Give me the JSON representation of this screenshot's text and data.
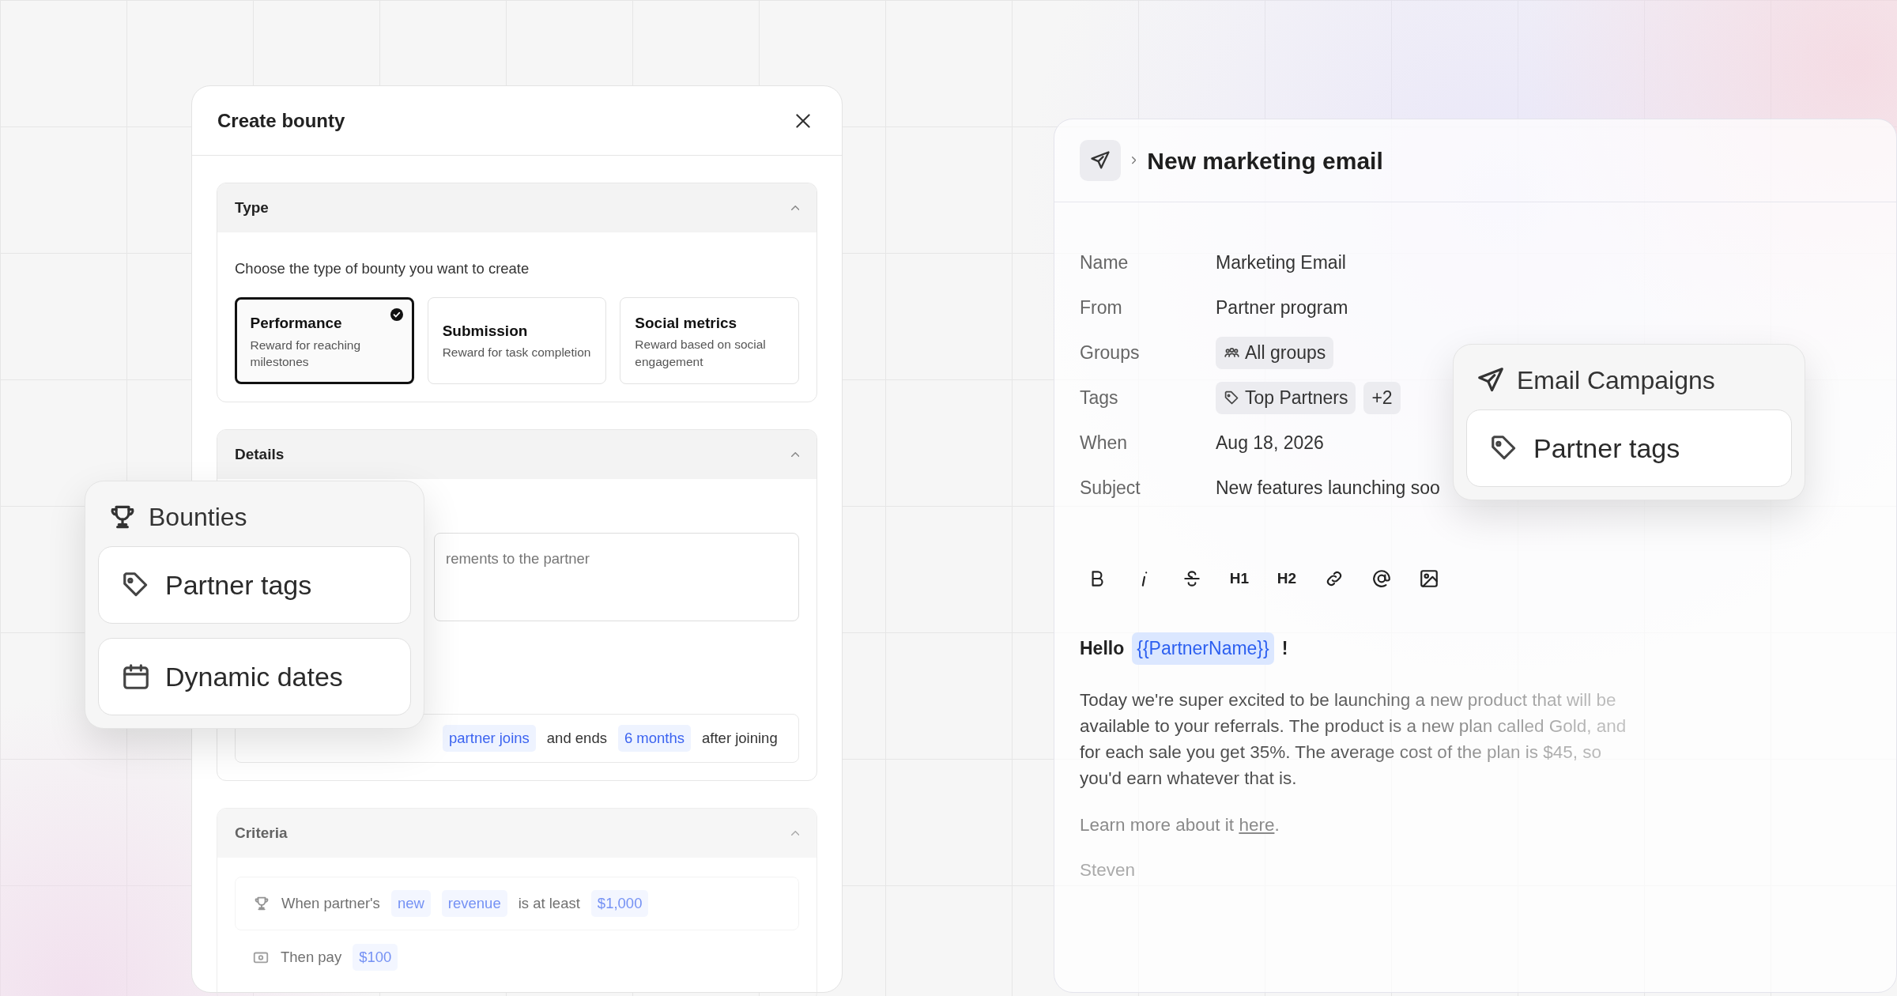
{
  "bounty_dialog": {
    "title": "Create bounty",
    "type_section": {
      "title": "Type",
      "expanded": true,
      "prompt": "Choose the type of bounty you want to create",
      "options": [
        {
          "title": "Performance",
          "description": "Reward for reaching milestones",
          "selected": true
        },
        {
          "title": "Submission",
          "description": "Reward for task completion",
          "selected": false
        },
        {
          "title": "Social metrics",
          "description": "Reward based on social engagement",
          "selected": false
        }
      ]
    },
    "details_section": {
      "title": "Details",
      "expanded": true,
      "placeholder": "rements to the partner",
      "date_rule": [
        {
          "kind": "chip",
          "text": "partner joins"
        },
        {
          "kind": "text",
          "text": "and ends"
        },
        {
          "kind": "chip",
          "text": "6 months"
        },
        {
          "kind": "text",
          "text": "after joining"
        }
      ]
    },
    "criteria_section": {
      "title": "Criteria",
      "expanded": true,
      "condition": [
        {
          "kind": "text",
          "text": "When partner's"
        },
        {
          "kind": "chip",
          "text": "new"
        },
        {
          "kind": "chip",
          "text": "revenue"
        },
        {
          "kind": "text",
          "text": "is at least"
        },
        {
          "kind": "chip",
          "text": "$1,000"
        }
      ],
      "payout": [
        {
          "kind": "text",
          "text": "Then pay"
        },
        {
          "kind": "chip",
          "text": "$100"
        }
      ]
    }
  },
  "feature_card_left": {
    "kind": "trophy",
    "title": "Bounties",
    "items": [
      {
        "kind": "tag",
        "label": "Partner tags"
      },
      {
        "kind": "calendar",
        "label": "Dynamic dates"
      }
    ]
  },
  "email_panel": {
    "title": "New marketing email",
    "fields": [
      {
        "label": "Name",
        "kind": "text",
        "value": "Marketing Email"
      },
      {
        "label": "From",
        "kind": "text",
        "value": "Partner program"
      },
      {
        "label": "Groups",
        "kind": "chips",
        "chips": [
          {
            "kind": "group",
            "text": "All groups"
          }
        ]
      },
      {
        "label": "Tags",
        "kind": "chips",
        "chips": [
          {
            "kind": "tag",
            "text": "Top Partners"
          },
          {
            "kind": "count",
            "text": "+2"
          }
        ]
      },
      {
        "label": "When",
        "kind": "text",
        "value": "Aug 18, 2026"
      },
      {
        "label": "Subject",
        "kind": "text",
        "value": "New features launching soo"
      }
    ],
    "toolbar": [
      {
        "kind": "bold"
      },
      {
        "kind": "italic"
      },
      {
        "kind": "strike"
      },
      {
        "kind": "text",
        "label": "H1"
      },
      {
        "kind": "text",
        "label": "H2"
      },
      {
        "kind": "link"
      },
      {
        "kind": "mention"
      },
      {
        "kind": "image"
      }
    ],
    "greeting": "Hello",
    "variable": "{{PartnerName}}",
    "greeting_end": "!",
    "body": "Today we're super excited to be launching a new product that will be available to your referrals. The product is a new plan called Gold, and for each sale you get 35%. The average cost of the plan is $45, so you'd earn whatever that is.",
    "learn_more": "Learn more about it",
    "link": "here",
    "link_end": ".",
    "signature": "Steven"
  },
  "feature_card_right": {
    "kind": "send",
    "title": "Email Campaigns",
    "items": [
      {
        "kind": "tag",
        "label": "Partner tags"
      }
    ]
  }
}
